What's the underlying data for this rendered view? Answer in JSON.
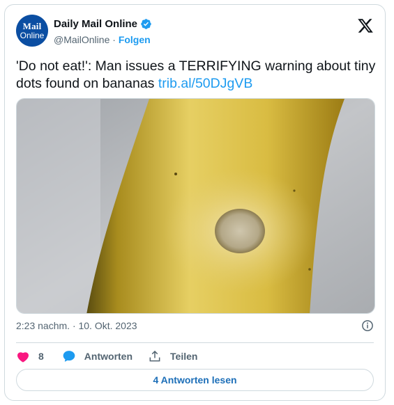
{
  "author": {
    "avatar_line1": "Mail",
    "avatar_line2": "Online",
    "name": "Daily Mail Online",
    "handle": "@MailOnline",
    "separator": " · ",
    "follow_label": "Folgen"
  },
  "tweet": {
    "text": "'Do not eat!': Man issues a TERRIFYING warning about tiny dots found on bananas ",
    "link": "trib.al/50DJgVB",
    "timestamp": "2:23 nachm. · 10. Okt. 2023"
  },
  "actions": {
    "likes_count": "8",
    "reply_label": "Antworten",
    "share_label": "Teilen"
  },
  "replies_button_label": "4 Antworten lesen",
  "icons": {
    "brand": "x-logo-icon",
    "verified": "verified-badge-icon",
    "info": "info-icon",
    "like": "heart-icon",
    "reply": "speech-bubble-icon",
    "share": "share-icon"
  },
  "colors": {
    "accent": "#1d9bf0",
    "like": "#f91880",
    "avatar": "#0b4ea2"
  }
}
